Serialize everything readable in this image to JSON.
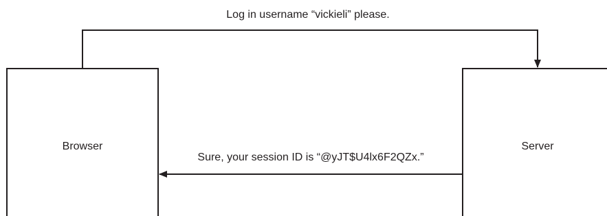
{
  "nodes": {
    "browser": {
      "label": "Browser"
    },
    "server": {
      "label": "Server"
    }
  },
  "messages": {
    "request": {
      "text": "Log in username “vickieli” please."
    },
    "response": {
      "text": "Sure, your session ID is “@yJT$U4lx6F2QZx.”"
    }
  },
  "colors": {
    "stroke": "#231f20",
    "background": "#ffffff"
  }
}
